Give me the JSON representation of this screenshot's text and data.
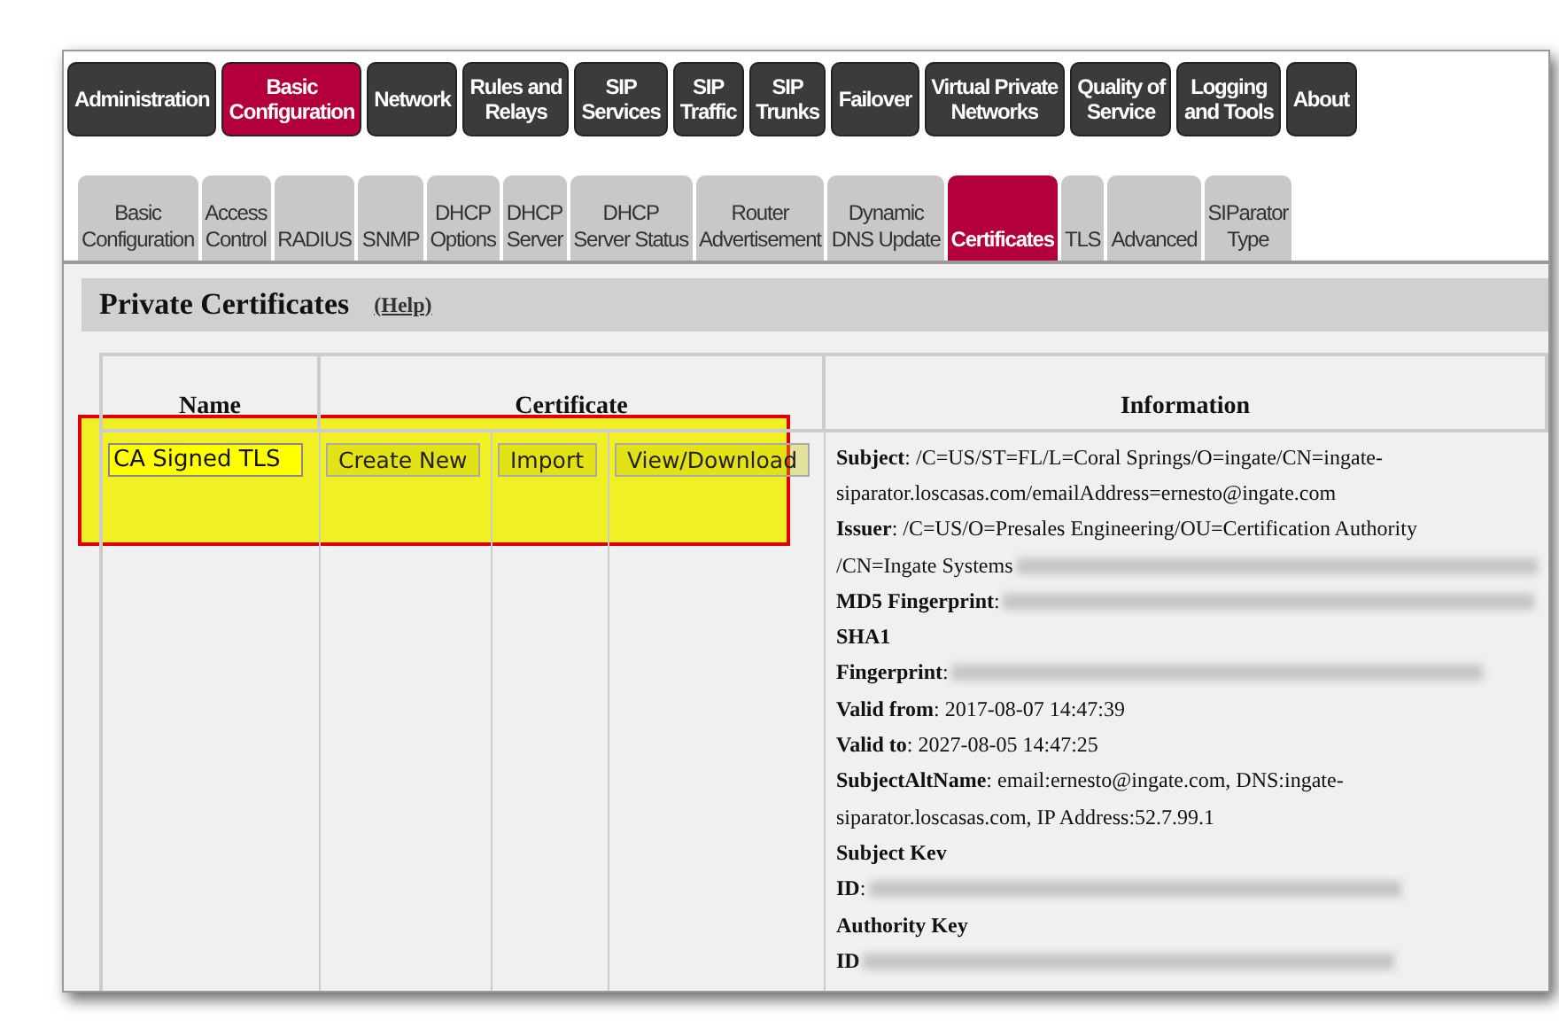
{
  "main_tabs": [
    {
      "label": "Administration",
      "selected": false
    },
    {
      "label": "Basic\nConfiguration",
      "selected": true
    },
    {
      "label": "Network",
      "selected": false
    },
    {
      "label": "Rules and\nRelays",
      "selected": false
    },
    {
      "label": "SIP\nServices",
      "selected": false
    },
    {
      "label": "SIP\nTraffic",
      "selected": false
    },
    {
      "label": "SIP\nTrunks",
      "selected": false
    },
    {
      "label": "Failover",
      "selected": false
    },
    {
      "label": "Virtual Private\nNetworks",
      "selected": false
    },
    {
      "label": "Quality of\nService",
      "selected": false
    },
    {
      "label": "Logging\nand Tools",
      "selected": false
    },
    {
      "label": "About",
      "selected": false
    }
  ],
  "sub_tabs": [
    {
      "label": "Basic\nConfiguration",
      "selected": false
    },
    {
      "label": "Access\nControl",
      "selected": false
    },
    {
      "label": "RADIUS",
      "selected": false
    },
    {
      "label": "SNMP",
      "selected": false
    },
    {
      "label": "DHCP\nOptions",
      "selected": false
    },
    {
      "label": "DHCP\nServer",
      "selected": false
    },
    {
      "label": "DHCP\nServer Status",
      "selected": false
    },
    {
      "label": "Router\nAdvertisement",
      "selected": false
    },
    {
      "label": "Dynamic\nDNS Update",
      "selected": false
    },
    {
      "label": "Certificates",
      "selected": true
    },
    {
      "label": "TLS",
      "selected": false
    },
    {
      "label": "Advanced",
      "selected": false
    },
    {
      "label": "SIParator\nType",
      "selected": false
    }
  ],
  "section": {
    "title": "Private Certificates",
    "help_link": "(Help)"
  },
  "table": {
    "columns": [
      "Name",
      "Certificate",
      "Information"
    ],
    "row": {
      "name_value": "CA Signed TLS",
      "buttons": [
        "Create New",
        "Import",
        "View/Download"
      ],
      "info_lines": [
        {
          "text": "**Subject**: /C=US/ST=FL/L=Coral Springs/O=ingate/CN=ingate-",
          "redacted": false
        },
        {
          "text": "siparator.loscasas.com/emailAddress=ernesto@ingate.com",
          "redacted": false
        },
        {
          "text": "**Issuer**: /C=US/O=Presales Engineering/OU=Certification Authority",
          "redacted": false
        },
        {
          "text": "/CN=Ingate Systems",
          "redacted": true
        },
        {
          "text": "**MD5 Fingerprint**:",
          "redacted": true
        },
        {
          "text": "**SHA1**",
          "redacted": false
        },
        {
          "text": "**Fingerprint**:",
          "redacted": true
        },
        {
          "text": "**Valid from**: 2017-08-07 14:47:39",
          "redacted": false
        },
        {
          "text": "**Valid to**: 2027-08-05 14:47:25",
          "redacted": false
        },
        {
          "text": "**SubjectAltName**: email:ernesto@ingate.com,  DNS:ingate-",
          "redacted": false
        },
        {
          "text": "siparator.loscasas.com,  IP Address:52.7.99.1",
          "redacted": false
        },
        {
          "text": "**Subject Kev**",
          "redacted": false
        },
        {
          "text": "**ID**:",
          "redacted": true
        },
        {
          "text": "**Authority Key**",
          "redacted": false
        },
        {
          "text": "**ID**",
          "redacted": true
        }
      ]
    }
  },
  "highlight": {
    "on": true
  }
}
